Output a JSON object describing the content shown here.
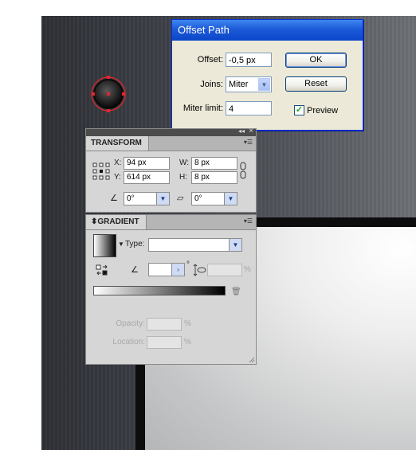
{
  "offset_path": {
    "title": "Offset Path",
    "offset_label": "Offset:",
    "offset_value": "-0,5 px",
    "joins_label": "Joins:",
    "joins_value": "Miter",
    "miter_label": "Miter limit:",
    "miter_value": "4",
    "ok_label": "OK",
    "cancel_label": "Reset",
    "preview_label": "Preview",
    "preview_checked": true
  },
  "transform": {
    "tab_label": "TRANSFORM",
    "x_label": "X:",
    "x_value": "94 px",
    "y_label": "Y:",
    "y_value": "614 px",
    "w_label": "W:",
    "w_value": "8 px",
    "h_label": "H:",
    "h_value": "8 px",
    "rotate_value": "0°",
    "shear_value": "0°"
  },
  "gradient": {
    "tab_label": "GRADIENT",
    "type_label": "Type:",
    "type_value": "",
    "angle_unit": "°",
    "aspect_unit": "%",
    "opacity_label": "Opacity:",
    "opacity_unit": "%",
    "location_label": "Location:",
    "location_unit": "%"
  },
  "panel_controls": {
    "collapse": "◂◂",
    "close": "×",
    "menu": "▾☰"
  },
  "colors": {
    "canvas_dark": "#3e4148",
    "selection": "#e8242c",
    "xp_title": "#1d5ad8"
  }
}
